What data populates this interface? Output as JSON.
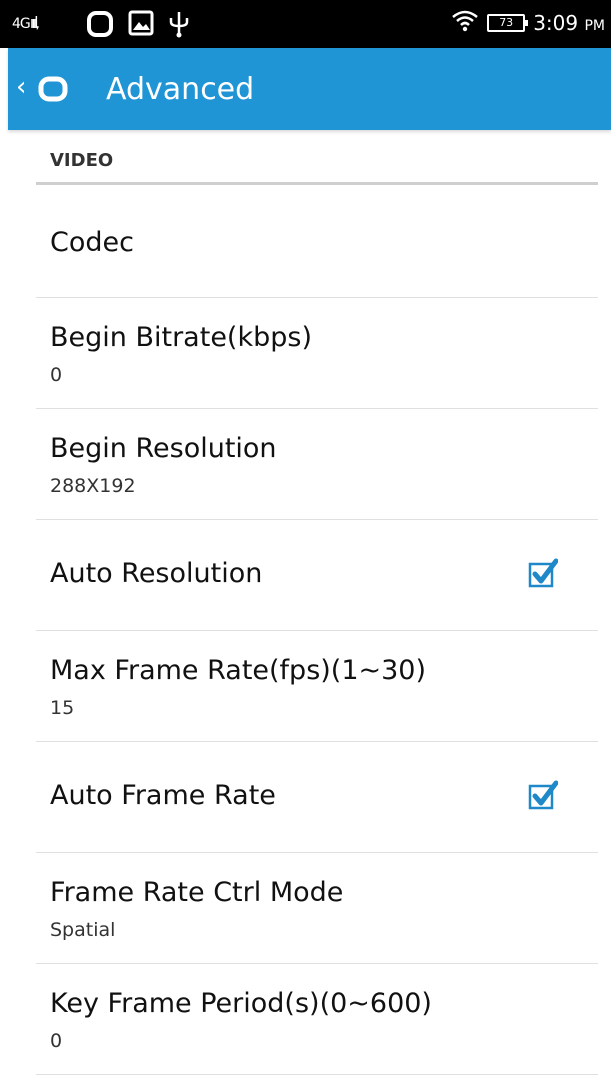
{
  "status_bar": {
    "network": "4Gᴵᴵᴵ‧",
    "battery": "73",
    "time": "3:09",
    "ampm": "PM"
  },
  "action_bar": {
    "title": "Advanced"
  },
  "section": {
    "header": "VIDEO"
  },
  "preferences": [
    {
      "title": "Codec"
    },
    {
      "title": "Begin Bitrate(kbps)",
      "summary": "0"
    },
    {
      "title": "Begin Resolution",
      "summary": "288X192"
    },
    {
      "title": "Auto Resolution",
      "checked": true
    },
    {
      "title": "Max Frame Rate(fps)(1~30)",
      "summary": "15"
    },
    {
      "title": "Auto Frame Rate",
      "checked": true
    },
    {
      "title": "Frame Rate Ctrl Mode",
      "summary": "Spatial"
    },
    {
      "title": "Key Frame Period(s)(0~600)",
      "summary": "0"
    }
  ],
  "colors": {
    "accent": "#1f95d6",
    "checkbox": "#1e88c8"
  }
}
